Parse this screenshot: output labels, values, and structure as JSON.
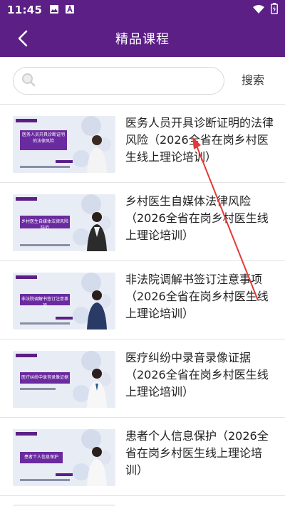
{
  "status_bar": {
    "time": "11:45",
    "icons": [
      "image-icon",
      "font-a-icon",
      "wifi-icon",
      "battery-icon"
    ]
  },
  "header": {
    "title": "精品课程",
    "back_icon": "chevron-left-icon"
  },
  "search": {
    "placeholder": "",
    "value": "",
    "button_label": "搜索"
  },
  "colors": {
    "brand": "#5b1f86",
    "thumb_banner": "#6a2aa0"
  },
  "courses": [
    {
      "title": "医务人员开具诊断证明的法律风险（2026全省在岗乡村医生线上理论培训）",
      "thumb_caption": "医务人员开具诊断证明的法律风险"
    },
    {
      "title": "乡村医生自媒体法律风险（2026全省在岗乡村医生线上理论培训）",
      "thumb_caption": "乡村医生自媒体法律风险防范"
    },
    {
      "title": "非法院调解书签订注意事项（2026全省在岗乡村医生线上理论培训）",
      "thumb_caption": "非法院调解书签订注意事项"
    },
    {
      "title": "医疗纠纷中录音录像证据（2026全省在岗乡村医生线上理论培训）",
      "thumb_caption": "医疗纠纷中录音录像证据"
    },
    {
      "title": "患者个人信息保护（2026全省在岗乡村医生线上理论培训）",
      "thumb_caption": "患者个人信息保护"
    }
  ]
}
